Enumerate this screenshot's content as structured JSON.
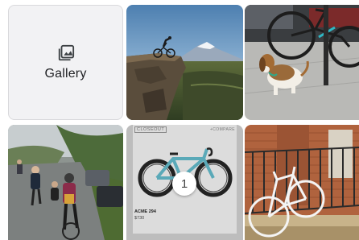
{
  "gallery": {
    "label": "Gallery",
    "icon": "photo-library-icon"
  },
  "product": {
    "tag": "CLOSEOUT",
    "compare": "+COMPARE",
    "name": "ACME 294",
    "price": "$730",
    "selection_count": "1"
  },
  "photos": [
    "mountain-bike-cliff-photo",
    "beagle-with-bicycle-photo",
    "road-race-cyclists-photo",
    "acme-294-gravel-bike-product-photo",
    "bicycle-on-porch-photo"
  ]
}
